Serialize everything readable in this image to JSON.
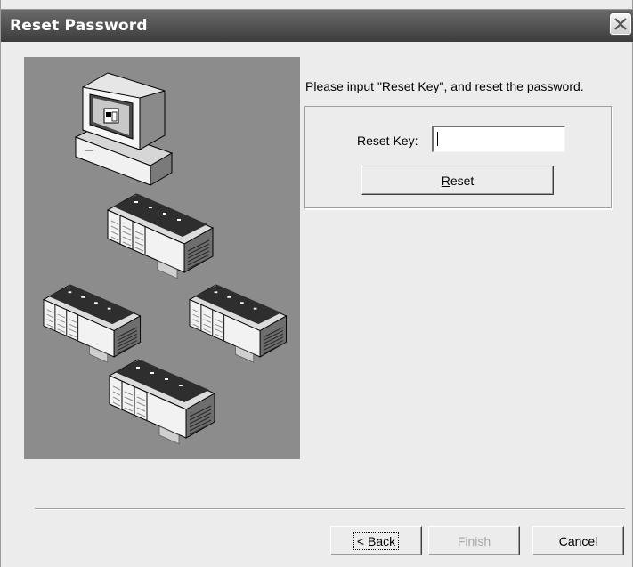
{
  "window": {
    "title": "Reset Password",
    "close_icon": "close-icon"
  },
  "instruction": "Please input \"Reset Key\", and reset the password.",
  "reset_key": {
    "label": "Reset Key:",
    "value": ""
  },
  "buttons": {
    "reset": {
      "mnemonic": "R",
      "rest": "eset"
    },
    "back": {
      "prefix": "< ",
      "mnemonic": "B",
      "rest": "ack"
    },
    "finish": "Finish",
    "cancel": "Cancel"
  },
  "illustration": {
    "icons": [
      "computer-icon",
      "plc-unit-icon"
    ],
    "colors": {
      "panel": "#8c8c8c"
    }
  }
}
